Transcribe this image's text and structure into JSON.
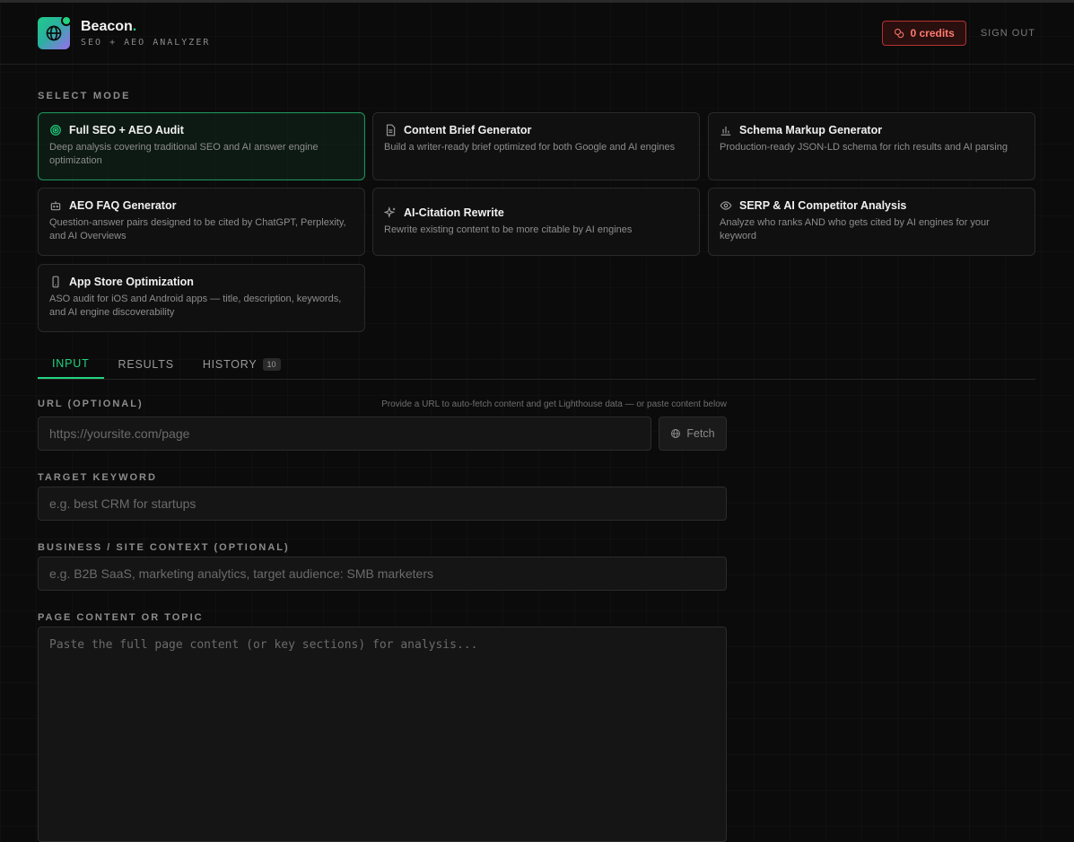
{
  "header": {
    "brand_name": "Beacon",
    "brand_dot": ".",
    "brand_tagline": "SEO + AEO ANALYZER",
    "credits_label": "0 credits",
    "signout_label": "SIGN OUT"
  },
  "modes": {
    "section_label": "SELECT MODE",
    "items": [
      {
        "title": "Full SEO + AEO Audit",
        "desc": "Deep analysis covering traditional SEO and AI answer engine optimization",
        "icon": "target-icon",
        "active": true
      },
      {
        "title": "Content Brief Generator",
        "desc": "Build a writer-ready brief optimized for both Google and AI engines",
        "icon": "document-icon"
      },
      {
        "title": "Schema Markup Generator",
        "desc": "Production-ready JSON-LD schema for rich results and AI parsing",
        "icon": "bar-chart-icon"
      },
      {
        "title": "AEO FAQ Generator",
        "desc": "Question-answer pairs designed to be cited by ChatGPT, Perplexity, and AI Overviews",
        "icon": "robot-icon"
      },
      {
        "title": "AI-Citation Rewrite",
        "desc": "Rewrite existing content to be more citable by AI engines",
        "icon": "sparkles-icon"
      },
      {
        "title": "SERP & AI Competitor Analysis",
        "desc": "Analyze who ranks AND who gets cited by AI engines for your keyword",
        "icon": "eye-icon"
      },
      {
        "title": "App Store Optimization",
        "desc": "ASO audit for iOS and Android apps — title, description, keywords, and AI engine discoverability",
        "icon": "phone-icon"
      }
    ]
  },
  "tabs": [
    {
      "label": "INPUT",
      "active": true
    },
    {
      "label": "RESULTS"
    },
    {
      "label": "HISTORY",
      "badge": "10"
    }
  ],
  "form": {
    "url_label": "URL (OPTIONAL)",
    "url_hint": "Provide a URL to auto-fetch content and get Lighthouse data — or paste content below",
    "url_placeholder": "https://yoursite.com/page",
    "fetch_label": "Fetch",
    "keyword_label": "TARGET KEYWORD",
    "keyword_placeholder": "e.g. best CRM for startups",
    "context_label": "BUSINESS / SITE CONTEXT (OPTIONAL)",
    "context_placeholder": "e.g. B2B SaaS, marketing analytics, target audience: SMB marketers",
    "content_label": "PAGE CONTENT OR TOPIC",
    "content_placeholder": "Paste the full page content (or key sections) for analysis..."
  },
  "colors": {
    "accent": "#22d37f",
    "danger": "#ff7a6e",
    "background": "#0b0b0b"
  }
}
